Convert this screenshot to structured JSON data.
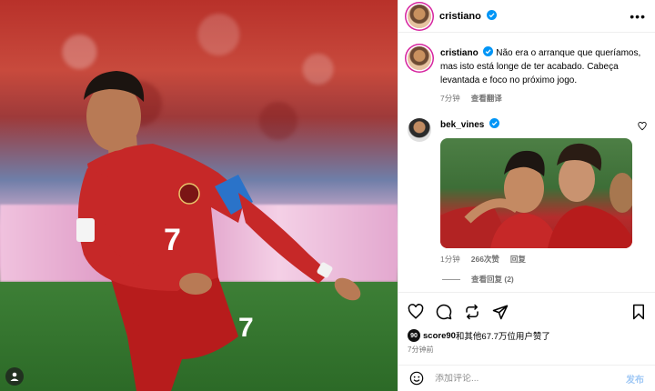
{
  "post": {
    "author": "cristiano",
    "more_icon": "more-horizontal-icon",
    "photo_jersey_number": "7"
  },
  "caption": {
    "author": "cristiano",
    "text": "Não era o arranque que queríamos, mas isto está longe de ter acabado. Cabeça levantada e foco no próximo jogo.",
    "time": "7分钟",
    "translate": "查看翻译"
  },
  "comment": {
    "author": "bek_vines",
    "time": "1分钟",
    "likes": "266次赞",
    "reply": "回复",
    "view_replies": "查看回复 (2)"
  },
  "actions": {
    "icons": [
      "heart-icon",
      "comment-icon",
      "share-icon",
      "send-icon",
      "bookmark-icon"
    ],
    "liker_badge": "90",
    "liker": "score90",
    "liked_text": "和其他67.7万位用户赞了",
    "posted_time": "7分钟前"
  },
  "composer": {
    "placeholder": "添加评论...",
    "post_label": "发布"
  },
  "colors": {
    "verified": "#0095f6",
    "post_disabled": "#9fc8f5",
    "jersey_red": "#c62828"
  }
}
